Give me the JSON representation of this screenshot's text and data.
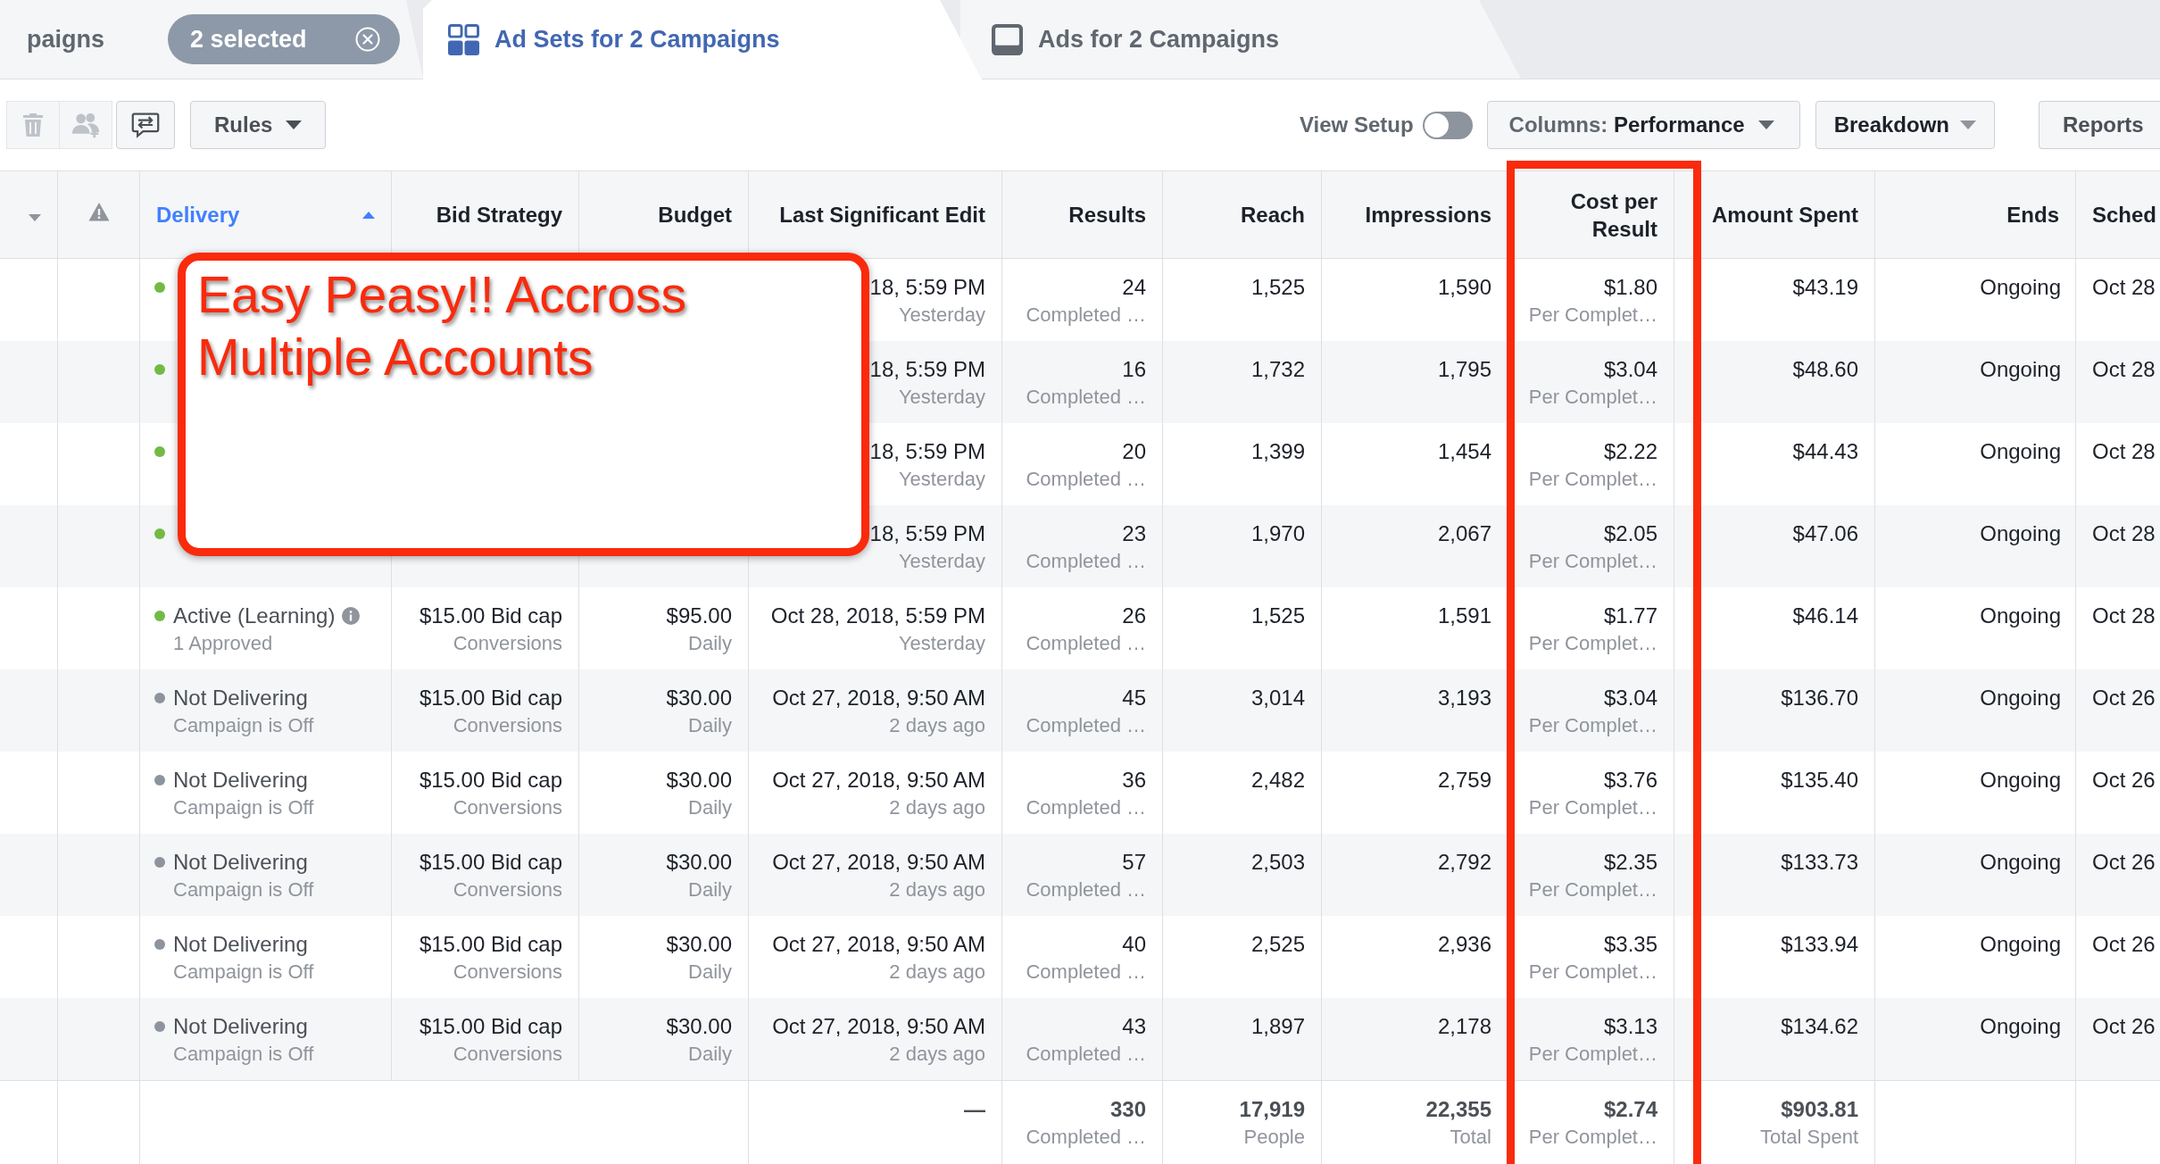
{
  "tabs": [
    {
      "kind": "campaign",
      "label": "paigns",
      "selected": false,
      "badge": "2 selected"
    },
    {
      "kind": "adset",
      "label": "Ad Sets for 2 Campaigns",
      "selected": true
    },
    {
      "kind": "ad",
      "label": "Ads for 2 Campaigns",
      "selected": false
    }
  ],
  "toolbar": {
    "actions": [
      {
        "kind": "delete",
        "disabled": true
      },
      {
        "kind": "audience",
        "disabled": true
      },
      {
        "kind": "share",
        "disabled": false
      }
    ],
    "rules": "Rules",
    "view_setup": {
      "label": "View Setup",
      "on": false
    },
    "columns": "Columns: **Performance**",
    "breakdown": "Breakdown",
    "reports": "Reports"
  },
  "table": {
    "columns": [
      {
        "kind": "menu",
        "sorted": false,
        "highlighted": false
      },
      {
        "kind": "alert",
        "sorted": false,
        "highlighted": false
      },
      {
        "kind": "status",
        "label": "Delivery",
        "sorted": true,
        "highlighted": false
      },
      {
        "kind": "text",
        "label": "Bid Strategy",
        "sorted": false,
        "highlighted": false
      },
      {
        "kind": "text",
        "label": "Budget",
        "sorted": false,
        "highlighted": false
      },
      {
        "kind": "text",
        "label": "Last Significant Edit",
        "sorted": false,
        "highlighted": false
      },
      {
        "kind": "text",
        "label": "Results",
        "sorted": false,
        "highlighted": false
      },
      {
        "kind": "text",
        "label": "Reach",
        "sorted": false,
        "highlighted": false
      },
      {
        "kind": "text",
        "label": "Impressions",
        "sorted": false,
        "highlighted": false
      },
      {
        "kind": "text",
        "label": "Cost per Result",
        "sorted": false,
        "highlighted": true
      },
      {
        "kind": "text",
        "label": "Amount Spent",
        "sorted": false,
        "highlighted": false
      },
      {
        "kind": "text",
        "label": "Ends",
        "sorted": false,
        "highlighted": false
      },
      {
        "kind": "schedule",
        "label": "Sched",
        "sorted": false,
        "highlighted": false
      }
    ],
    "rows": [
      {
        "cells": [
          "",
          "",
          {
            "color": "#72ba45"
          },
          "",
          "",
          {
            "value": "18, 5:59 PM",
            "detail": "Yesterday"
          },
          {
            "value": "24",
            "detail": "Completed …"
          },
          {
            "value": "1,525"
          },
          {
            "value": "1,590"
          },
          {
            "value": "$1.80",
            "detail": "Per Complet…"
          },
          {
            "value": "$43.19"
          },
          {
            "value": "Ongoing"
          },
          {
            "value": "Oct 28"
          }
        ]
      },
      {
        "cells": [
          "",
          "",
          {
            "color": "#72ba45"
          },
          "",
          "",
          {
            "value": "18, 5:59 PM",
            "detail": "Yesterday"
          },
          {
            "value": "16",
            "detail": "Completed …"
          },
          {
            "value": "1,732"
          },
          {
            "value": "1,795"
          },
          {
            "value": "$3.04",
            "detail": "Per Complet…"
          },
          {
            "value": "$48.60"
          },
          {
            "value": "Ongoing"
          },
          {
            "value": "Oct 28"
          }
        ]
      },
      {
        "cells": [
          "",
          "",
          {
            "color": "#72ba45"
          },
          "",
          "",
          {
            "value": "18, 5:59 PM",
            "detail": "Yesterday"
          },
          {
            "value": "20",
            "detail": "Completed …"
          },
          {
            "value": "1,399"
          },
          {
            "value": "1,454"
          },
          {
            "value": "$2.22",
            "detail": "Per Complet…"
          },
          {
            "value": "$44.43"
          },
          {
            "value": "Ongoing"
          },
          {
            "value": "Oct 28"
          }
        ]
      },
      {
        "cells": [
          "",
          "",
          {
            "color": "#72ba45"
          },
          "",
          "",
          {
            "value": "18, 5:59 PM",
            "detail": "Yesterday"
          },
          {
            "value": "23",
            "detail": "Completed …"
          },
          {
            "value": "1,970"
          },
          {
            "value": "2,067"
          },
          {
            "value": "$2.05",
            "detail": "Per Complet…"
          },
          {
            "value": "$47.06"
          },
          {
            "value": "Ongoing"
          },
          {
            "value": "Oct 28"
          }
        ]
      },
      {
        "cells": [
          "",
          "",
          {
            "color": "#72ba45",
            "value": "Active (Learning)",
            "detail": "1 Approved",
            "info": true
          },
          {
            "value": "$15.00 Bid cap",
            "detail": "Conversions"
          },
          {
            "value": "$95.00",
            "detail": "Daily"
          },
          {
            "value": "Oct 28, 2018, 5:59 PM",
            "detail": "Yesterday"
          },
          {
            "value": "26",
            "detail": "Completed …"
          },
          {
            "value": "1,525"
          },
          {
            "value": "1,591"
          },
          {
            "value": "$1.77",
            "detail": "Per Complet…"
          },
          {
            "value": "$46.14"
          },
          {
            "value": "Ongoing"
          },
          {
            "value": "Oct 28"
          }
        ]
      },
      {
        "cells": [
          "",
          "",
          {
            "color": "#8d949e",
            "value": "Not Delivering",
            "detail": "Campaign is Off",
            "info": false
          },
          {
            "value": "$15.00 Bid cap",
            "detail": "Conversions"
          },
          {
            "value": "$30.00",
            "detail": "Daily"
          },
          {
            "value": "Oct 27, 2018, 9:50 AM",
            "detail": "2 days ago"
          },
          {
            "value": "45",
            "detail": "Completed …"
          },
          {
            "value": "3,014"
          },
          {
            "value": "3,193"
          },
          {
            "value": "$3.04",
            "detail": "Per Complet…"
          },
          {
            "value": "$136.70"
          },
          {
            "value": "Ongoing"
          },
          {
            "value": "Oct 26"
          }
        ]
      },
      {
        "cells": [
          "",
          "",
          {
            "color": "#8d949e",
            "value": "Not Delivering",
            "detail": "Campaign is Off",
            "info": false
          },
          {
            "value": "$15.00 Bid cap",
            "detail": "Conversions"
          },
          {
            "value": "$30.00",
            "detail": "Daily"
          },
          {
            "value": "Oct 27, 2018, 9:50 AM",
            "detail": "2 days ago"
          },
          {
            "value": "36",
            "detail": "Completed …"
          },
          {
            "value": "2,482"
          },
          {
            "value": "2,759"
          },
          {
            "value": "$3.76",
            "detail": "Per Complet…"
          },
          {
            "value": "$135.40"
          },
          {
            "value": "Ongoing"
          },
          {
            "value": "Oct 26"
          }
        ]
      },
      {
        "cells": [
          "",
          "",
          {
            "color": "#8d949e",
            "value": "Not Delivering",
            "detail": "Campaign is Off",
            "info": false
          },
          {
            "value": "$15.00 Bid cap",
            "detail": "Conversions"
          },
          {
            "value": "$30.00",
            "detail": "Daily"
          },
          {
            "value": "Oct 27, 2018, 9:50 AM",
            "detail": "2 days ago"
          },
          {
            "value": "57",
            "detail": "Completed …"
          },
          {
            "value": "2,503"
          },
          {
            "value": "2,792"
          },
          {
            "value": "$2.35",
            "detail": "Per Complet…"
          },
          {
            "value": "$133.73"
          },
          {
            "value": "Ongoing"
          },
          {
            "value": "Oct 26"
          }
        ]
      },
      {
        "cells": [
          "",
          "",
          {
            "color": "#8d949e",
            "value": "Not Delivering",
            "detail": "Campaign is Off",
            "info": false
          },
          {
            "value": "$15.00 Bid cap",
            "detail": "Conversions"
          },
          {
            "value": "$30.00",
            "detail": "Daily"
          },
          {
            "value": "Oct 27, 2018, 9:50 AM",
            "detail": "2 days ago"
          },
          {
            "value": "40",
            "detail": "Completed …"
          },
          {
            "value": "2,525"
          },
          {
            "value": "2,936"
          },
          {
            "value": "$3.35",
            "detail": "Per Complet…"
          },
          {
            "value": "$133.94"
          },
          {
            "value": "Ongoing"
          },
          {
            "value": "Oct 26"
          }
        ]
      },
      {
        "cells": [
          "",
          "",
          {
            "color": "#8d949e",
            "value": "Not Delivering",
            "detail": "Campaign is Off",
            "info": false
          },
          {
            "value": "$15.00 Bid cap",
            "detail": "Conversions"
          },
          {
            "value": "$30.00",
            "detail": "Daily"
          },
          {
            "value": "Oct 27, 2018, 9:50 AM",
            "detail": "2 days ago"
          },
          {
            "value": "43",
            "detail": "Completed …"
          },
          {
            "value": "1,897"
          },
          {
            "value": "2,178"
          },
          {
            "value": "$3.13",
            "detail": "Per Complet…"
          },
          {
            "value": "$134.62"
          },
          {
            "value": "Ongoing"
          },
          {
            "value": "Oct 26"
          }
        ]
      }
    ],
    "totals": {
      "cells": [
        "",
        "",
        "",
        "",
        "",
        {
          "value": "—"
        },
        {
          "value": "330",
          "detail": "Completed …"
        },
        {
          "value": "17,919",
          "detail": "People"
        },
        {
          "value": "22,355",
          "detail": "Total"
        },
        {
          "value": "$2.74",
          "detail": "Per Complet…"
        },
        {
          "value": "$903.81",
          "detail": "Total Spent"
        },
        "",
        ""
      ]
    }
  },
  "callout": {
    "text": "Easy Peasy!! Accross Multiple Accounts"
  }
}
